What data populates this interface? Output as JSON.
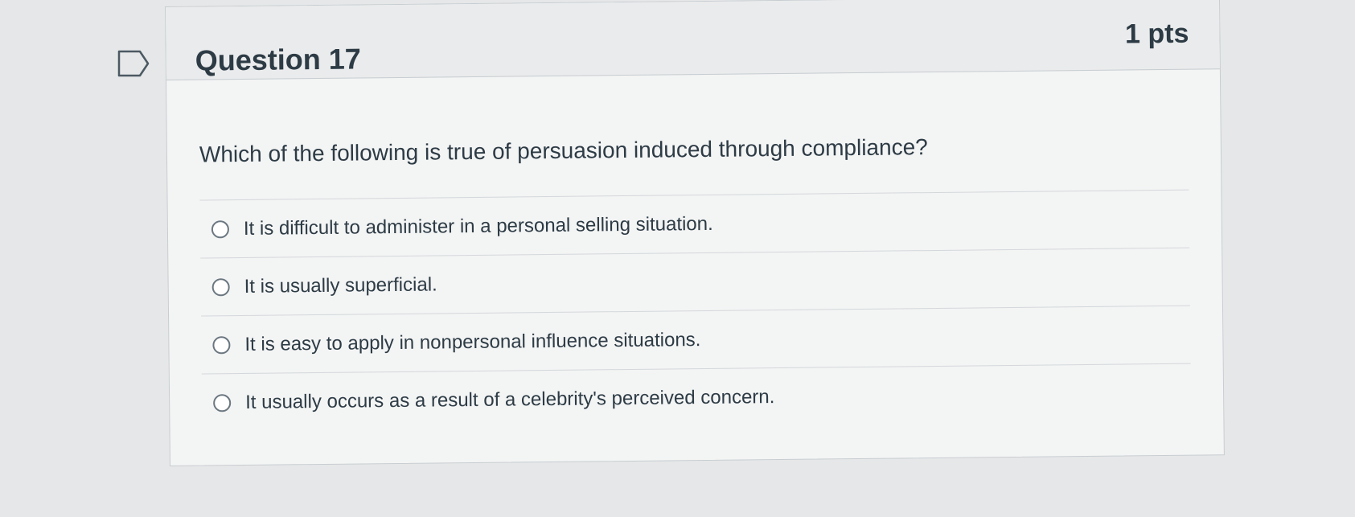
{
  "question": {
    "title": "Question 17",
    "points": "1 pts",
    "text": "Which of the following is true of persuasion induced through compliance?",
    "flag_icon": "flag-icon"
  },
  "answers": [
    {
      "label": "It is difficult to administer in a personal selling situation."
    },
    {
      "label": "It is usually superficial."
    },
    {
      "label": "It is easy to apply in nonpersonal influence situations."
    },
    {
      "label": "It usually occurs as a result of a celebrity's perceived concern."
    }
  ]
}
